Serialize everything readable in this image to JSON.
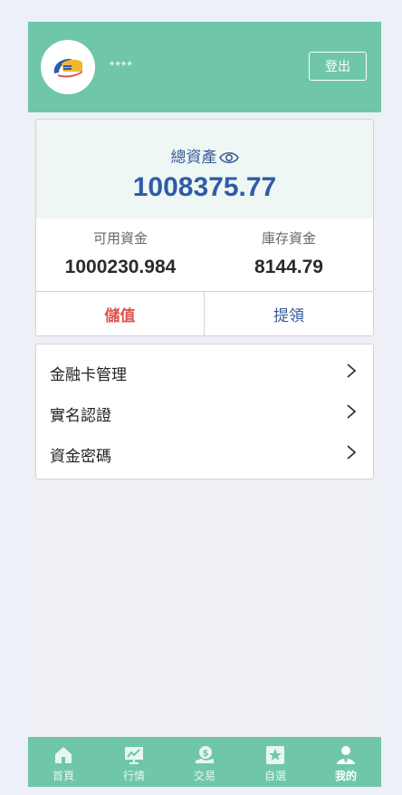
{
  "header": {
    "username": "****",
    "logout_label": "登出"
  },
  "assets": {
    "total_label": "總資產",
    "total_value": "1008375.77",
    "available_label": "可用資金",
    "available_value": "1000230.984",
    "stock_label": "庫存資金",
    "stock_value": "8144.79",
    "deposit_label": "儲值",
    "withdraw_label": "提領"
  },
  "menu": {
    "items": [
      {
        "label": "金融卡管理"
      },
      {
        "label": "實名認證"
      },
      {
        "label": "資金密碼"
      }
    ]
  },
  "tabbar": {
    "tabs": [
      {
        "label": "首頁",
        "icon": "home-icon"
      },
      {
        "label": "行情",
        "icon": "chart-icon"
      },
      {
        "label": "交易",
        "icon": "trade-icon"
      },
      {
        "label": "自選",
        "icon": "star-icon"
      },
      {
        "label": "我的",
        "icon": "user-icon"
      }
    ],
    "active_index": 4
  },
  "colors": {
    "brand_green": "#6fc7a8",
    "accent_blue": "#2f5ba8",
    "deposit_red": "#e0524f"
  }
}
